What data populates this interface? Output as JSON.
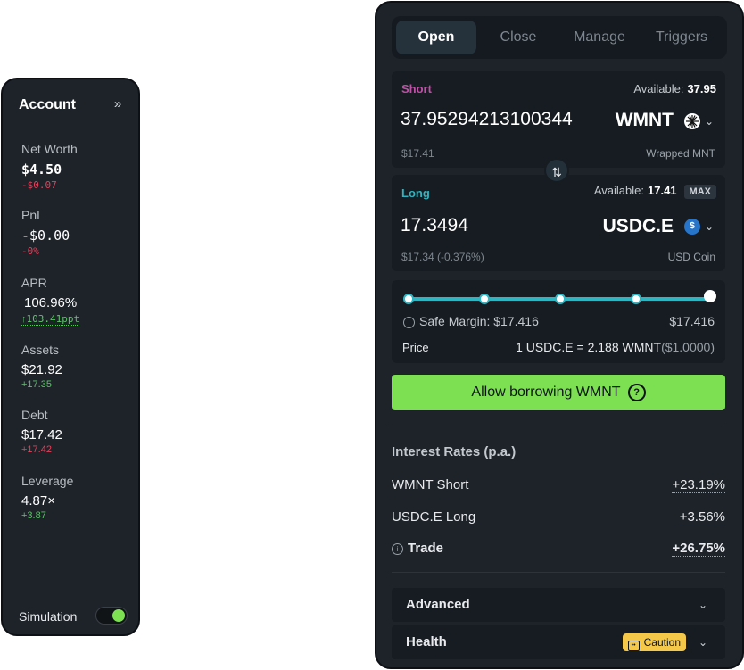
{
  "account": {
    "title": "Account",
    "stats": [
      {
        "label": "Net Worth",
        "value": "$4.50",
        "delta": "-$0.07"
      },
      {
        "label": "PnL",
        "value": "-$0.00",
        "delta": "-0%"
      },
      {
        "label": "APR",
        "value": "106.96%",
        "delta": "103.41ppt"
      },
      {
        "label": "Assets",
        "value": "$21.92",
        "delta": "+17.35"
      },
      {
        "label": "Debt",
        "value": "$17.42",
        "delta": "+17.42"
      },
      {
        "label": "Leverage",
        "value": "4.87×",
        "delta": "+3.87"
      }
    ],
    "simulation_label": "Simulation",
    "simulation_on": true
  },
  "tabs": [
    "Open",
    "Close",
    "Manage",
    "Triggers"
  ],
  "short": {
    "label": "Short",
    "available_label": "Available:",
    "available": "37.95",
    "amount": "37.95294213100344",
    "token": "WMNT",
    "usd": "$17.41",
    "token_name": "Wrapped MNT"
  },
  "long": {
    "label": "Long",
    "available_label": "Available:",
    "available": "17.41",
    "max": "MAX",
    "amount": "17.3494",
    "token": "USDC.E",
    "usd": "$17.34 (-0.376%)",
    "token_name": "USD Coin"
  },
  "slider": {
    "safe_margin_label": "Safe Margin:",
    "safe_margin_value": "$17.416",
    "right_value": "$17.416",
    "price_label": "Price",
    "price_value": "1 USDC.E = 2.188 WMNT",
    "price_usd": "($1.0000)",
    "fraction": 1.0
  },
  "allow_button": "Allow borrowing WMNT",
  "interest": {
    "title": "Interest Rates (p.a.)",
    "rows": [
      {
        "label": "WMNT Short",
        "value": "+23.19%"
      },
      {
        "label": "USDC.E Long",
        "value": "+3.56%"
      },
      {
        "label": "Trade",
        "value": "+26.75%"
      }
    ]
  },
  "advanced_label": "Advanced",
  "health_label": "Health",
  "health_badge": "Caution",
  "colors": {
    "accent_green": "#7de052",
    "short": "#c050a8",
    "long": "#2fb5c2",
    "negative": "#e0415a",
    "positive": "#5ec26a",
    "caution": "#f5c84a"
  }
}
